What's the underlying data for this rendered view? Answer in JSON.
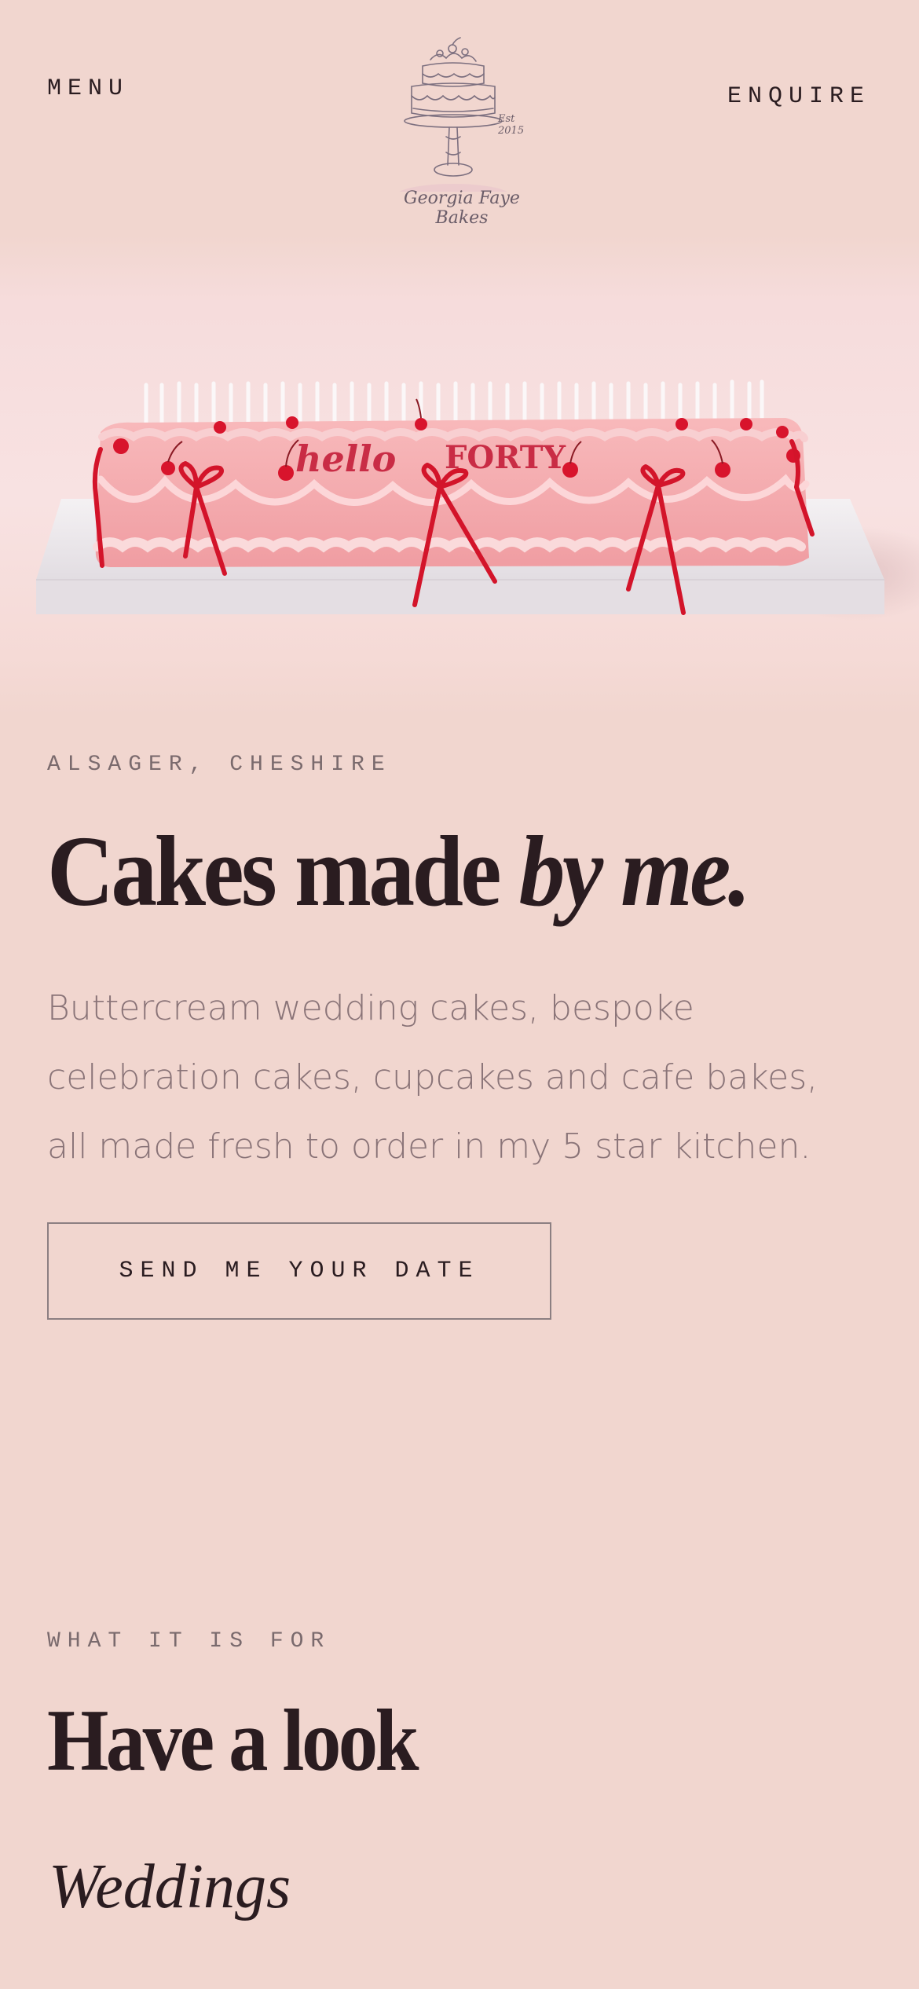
{
  "header": {
    "menu_label": "MENU",
    "enquire_label": "ENQUIRE",
    "logo": {
      "name": "Georgia Faye Bakes",
      "est": "Est 2015",
      "icon": "tiered-cake-stand-logo"
    }
  },
  "hero": {
    "image": "long-pink-buttercream-cake-with-red-bows-cherries-and-candles",
    "cake_text_1": "hello",
    "cake_text_2": "FORTY"
  },
  "intro": {
    "location": "ALSAGER, CHESHIRE",
    "headline_plain": "Cakes made ",
    "headline_italic": "by me.",
    "body": "Buttercream wedding cakes, bespoke celebration cakes, cupcakes and cafe bakes, all made fresh to order in my 5 star kitchen.",
    "cta_label": "SEND ME YOUR DATE"
  },
  "look": {
    "eyebrow": "WHAT IT IS FOR",
    "title": "Have a look",
    "first_category": "Weddings"
  },
  "colors": {
    "background": "#f1d6cf",
    "text_dark": "#2a1c20",
    "text_muted": "#8a7478",
    "eyebrow": "#7a6a6d",
    "cake_pink": "#f5a6a9",
    "ribbon_red": "#d3142a",
    "cake_board": "#ece8ec"
  }
}
